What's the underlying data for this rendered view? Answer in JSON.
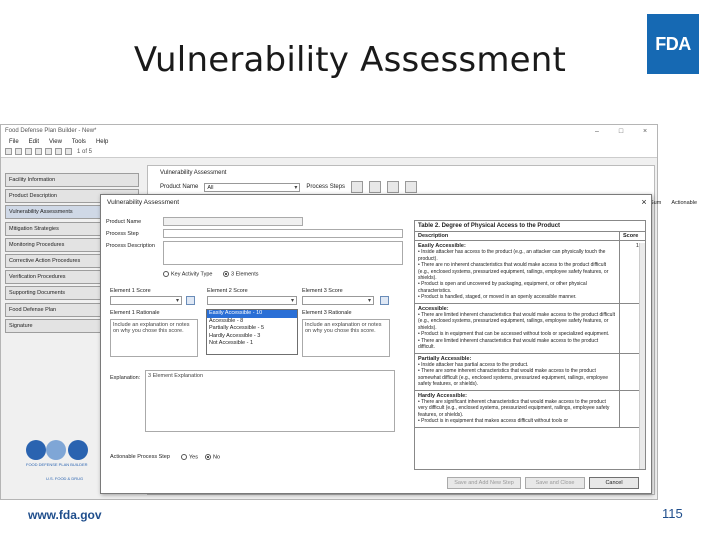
{
  "slide": {
    "title": "Vulnerability Assessment",
    "logo_text": "FDA",
    "footer_url": "www.fda.gov",
    "page_number": "115"
  },
  "app": {
    "window_title": "Food Defense Plan Builder - New*",
    "menu": [
      "File",
      "Edit",
      "View",
      "Tools",
      "Help"
    ],
    "toolbar_page": "1 of 5",
    "sidebar": [
      "Facility Information",
      "Product Description",
      "Vulnerability Assessments",
      "Mitigation Strategies",
      "Monitoring Procedures",
      "Corrective Action Procedures",
      "Verification Procedures",
      "Supporting Documents",
      "Food Defense Plan",
      "Signature"
    ],
    "main": {
      "title": "Vulnerability Assessment",
      "product_name_label": "Product Name",
      "product_name_value": "All",
      "process_steps_label": "Process Steps",
      "grid_headers": [
        "Sum",
        "Actionable"
      ]
    }
  },
  "dialog": {
    "title": "Vulnerability Assessment",
    "product_name_label": "Product Name",
    "process_step_label": "Process Step",
    "process_description_label": "Process Description",
    "radio_key_activity": "Key Activity Type",
    "radio_3_elements": "3 Elements",
    "element1_score": "Element 1 Score",
    "element2_score": "Element 2 Score",
    "element3_score": "Element 3 Score",
    "element1_rationale": "Element 1 Rationale",
    "element2_rationale": "Element 2 Rationale",
    "element3_rationale": "Element 3 Rationale",
    "rationale_placeholder": "Include an explanation or notes on why you chose this score.",
    "score_options": [
      "Easily Accessible - 10",
      "Accessible - 8",
      "Partially Accessible - 5",
      "Hardly Accessible - 3",
      "Not Accessible - 1"
    ],
    "explanation_label": "Explanation:",
    "explanation_value": "3 Element Explanation",
    "actionable_label": "Actionable Process Step",
    "actionable_yes": "Yes",
    "actionable_no": "No",
    "buttons": {
      "save_add_new": "Save and Add New Step",
      "save_close": "Save and Close",
      "cancel": "Cancel"
    },
    "table2": {
      "title": "Table 2. Degree of Physical Access to the Product",
      "col_description": "Description",
      "col_score": "Score",
      "rows": [
        {
          "category": "Easily Accessible:",
          "score": "10",
          "bullets": [
            "Inside attacker has access to the product (e.g., an attacker can physically touch the product).",
            "There are no inherent characteristics that would make access to the product difficult (e.g., enclosed systems, pressurized equipment, railings, employee safety features, or shields).",
            "Product is open and uncovered by packaging, equipment, or other physical characteristics.",
            "Product is handled, staged, or moved in an openly accessible manner."
          ]
        },
        {
          "category": "Accessible:",
          "score": "8",
          "bullets": [
            "There are limited inherent characteristics that would make access to the product difficult (e.g., enclosed systems, pressurized equipment, railings, employee safety features, or shields).",
            "Product is in equipment that can be accessed without tools or specialized equipment.",
            "There are limited inherent characteristics that would make access to the product difficult."
          ]
        },
        {
          "category": "Partially Accessible:",
          "score": "5",
          "bullets": [
            "Inside attacker has partial access to the product.",
            "There are some inherent characteristics that would make access to the product somewhat difficult (e.g., enclosed systems, pressurized equipment, railings, employee safety features, or shields)."
          ]
        },
        {
          "category": "Hardly Accessible:",
          "score": "3",
          "bullets": [
            "There are significant inherent characteristics that would make access to the product very difficult (e.g., enclosed systems, pressurized equipment, railings, employee safety features, or shields).",
            "Product is in equipment that makes access difficult without tools or"
          ]
        }
      ]
    }
  },
  "logos": {
    "fdpb_caption": "FOOD DEFENSE PLAN BUILDER",
    "fda_caption": "U.S. FOOD & DRUG"
  },
  "colors": {
    "fda_blue": "#1669b3",
    "selected_option": "#2a6fd6",
    "footer_text": "#1f4e8c"
  }
}
